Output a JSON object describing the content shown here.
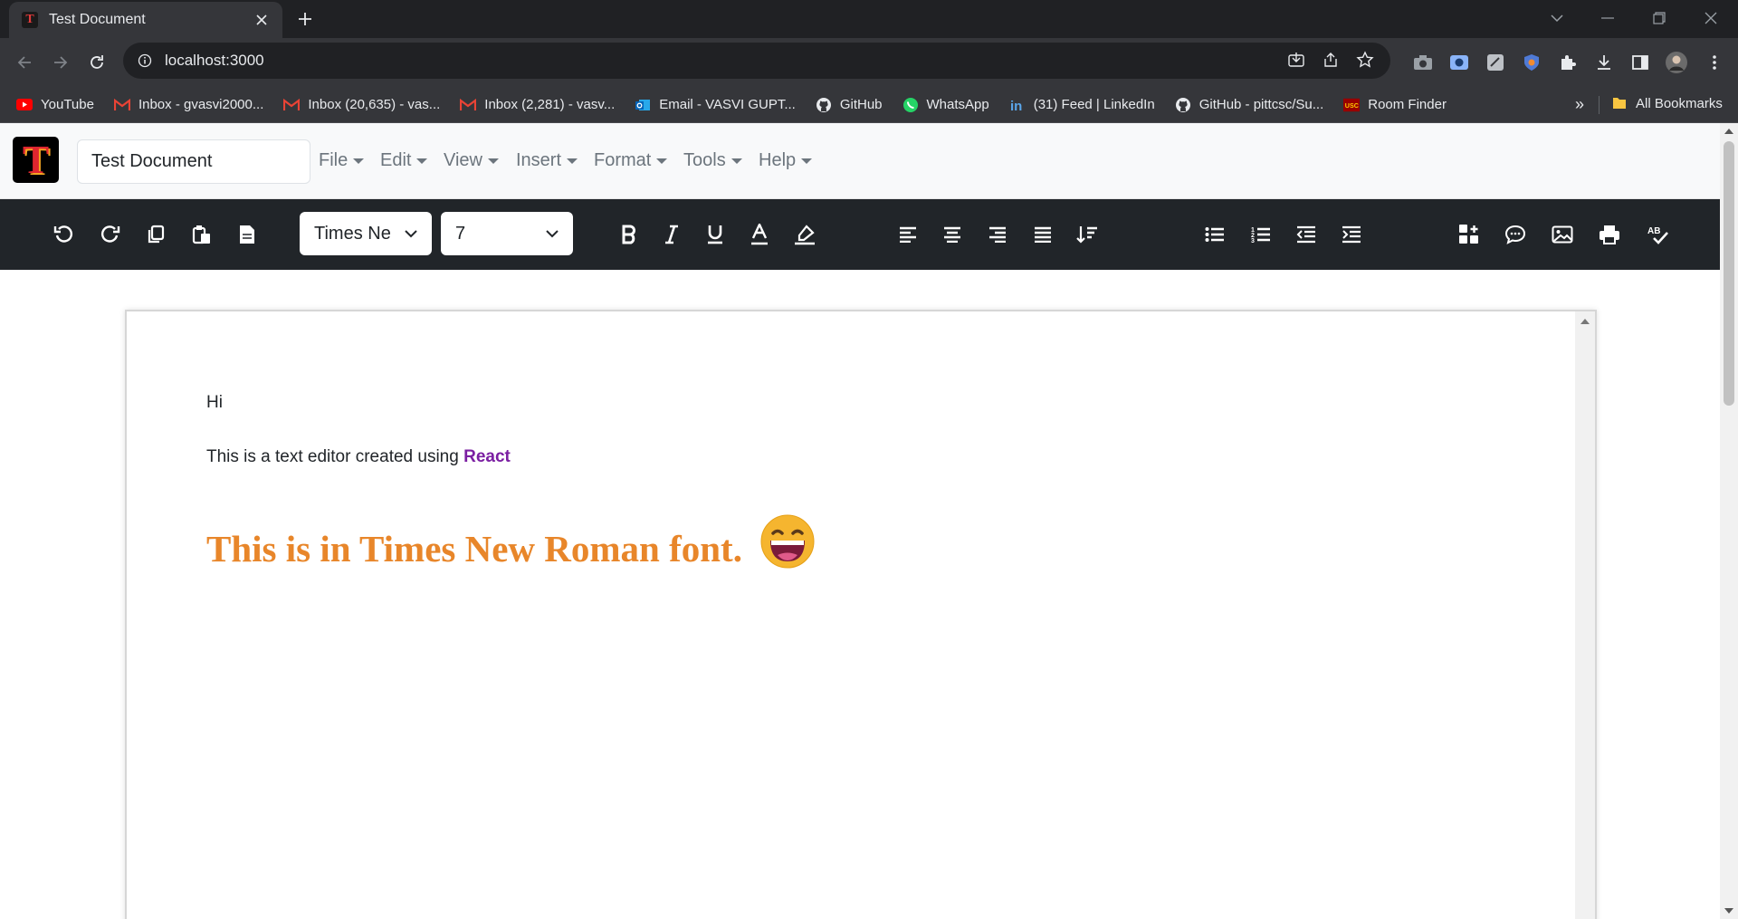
{
  "browser": {
    "tab_title": "Test Document",
    "url": "localhost:3000",
    "bookmarks": [
      {
        "label": "YouTube",
        "icon": "youtube-icon"
      },
      {
        "label": "Inbox - gvasvi2000...",
        "icon": "gmail-icon"
      },
      {
        "label": "Inbox (20,635) - vas...",
        "icon": "gmail-icon"
      },
      {
        "label": "Inbox (2,281) - vasv...",
        "icon": "gmail-icon"
      },
      {
        "label": "Email - VASVI GUPT...",
        "icon": "outlook-icon"
      },
      {
        "label": "GitHub",
        "icon": "github-icon"
      },
      {
        "label": "WhatsApp",
        "icon": "whatsapp-icon"
      },
      {
        "label": "(31) Feed | LinkedIn",
        "icon": "linkedin-icon"
      },
      {
        "label": "GitHub - pittcsc/Su...",
        "icon": "github-icon"
      },
      {
        "label": "Room Finder",
        "icon": "usc-icon"
      }
    ],
    "more_bookmarks": "»",
    "all_bookmarks": "All Bookmarks"
  },
  "app": {
    "logo_letter": "T",
    "doc_title": "Test Document",
    "menus": [
      "File",
      "Edit",
      "View",
      "Insert",
      "Format",
      "Tools",
      "Help"
    ],
    "font_family": "Times Ne",
    "font_size": "7"
  },
  "document": {
    "line1": "Hi",
    "line2_prefix": "This is a text editor created using ",
    "line2_highlight": "React",
    "line3": "This is in Times New Roman font.",
    "emoji": "grinning-face-emoji"
  },
  "colors": {
    "toolbar_bg": "#212529",
    "react_text": "#7b1fa2",
    "heading_text": "#e8862a"
  }
}
